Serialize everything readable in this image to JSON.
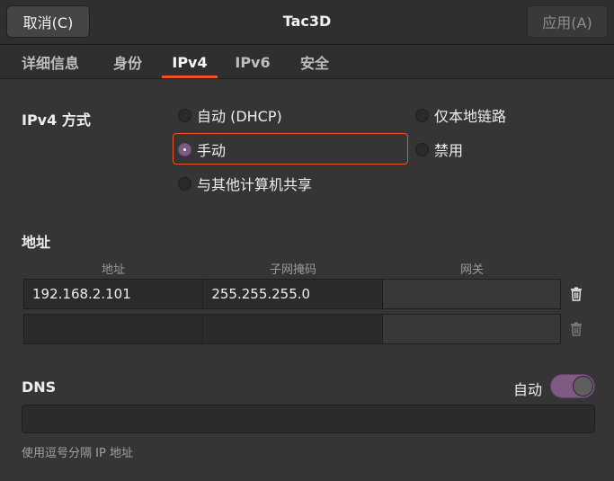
{
  "header": {
    "title": "Tac3D",
    "cancel_label": "取消(C)",
    "apply_label": "应用(A)"
  },
  "tabs": [
    {
      "label": "详细信息",
      "active": false
    },
    {
      "label": "身份",
      "active": false
    },
    {
      "label": "IPv4",
      "active": true
    },
    {
      "label": "IPv6",
      "active": false
    },
    {
      "label": "安全",
      "active": false
    }
  ],
  "ipv4_method": {
    "label": "IPv4 方式",
    "options": [
      {
        "label": "自动 (DHCP)",
        "checked": false
      },
      {
        "label": "仅本地链路",
        "checked": false
      },
      {
        "label": "手动",
        "checked": true
      },
      {
        "label": "禁用",
        "checked": false
      },
      {
        "label": "与其他计算机共享",
        "checked": false
      }
    ]
  },
  "address": {
    "label": "地址",
    "columns": [
      "地址",
      "子网掩码",
      "网关"
    ],
    "rows": [
      [
        "192.168.2.101",
        "255.255.255.0",
        ""
      ],
      [
        "",
        "",
        ""
      ]
    ]
  },
  "dns": {
    "label": "DNS",
    "auto_label": "自动",
    "auto_enabled": true,
    "value": "",
    "hint": "使用逗号分隔 IP 地址"
  },
  "colors": {
    "accent": "#e95420",
    "toggle": "#7e5a85"
  },
  "icons": {
    "delete": "trash-icon"
  }
}
